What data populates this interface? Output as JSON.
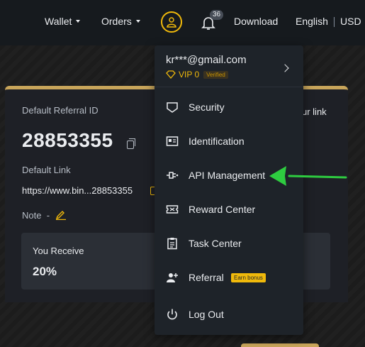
{
  "topbar": {
    "wallet_label": "Wallet",
    "orders_label": "Orders",
    "notification_count": "36",
    "download_label": "Download",
    "language_label": "English",
    "currency_label": "USD"
  },
  "referral": {
    "default_id_label": "Default Referral ID",
    "referral_id": "28853355",
    "default_link_label": "Default Link",
    "default_link": "https://www.bin...28853355",
    "note_label": "Note",
    "note_value": "-",
    "your_link_label": "ur link",
    "you_receive_label": "You Receive",
    "you_receive_value": "20%"
  },
  "dropdown": {
    "email": "kr***@gmail.com",
    "vip_label": "VIP 0",
    "verified_label": "Verified",
    "items": [
      {
        "label": "Security",
        "icon": "security-icon"
      },
      {
        "label": "Identification",
        "icon": "id-card-icon"
      },
      {
        "label": "API Management",
        "icon": "api-plug-icon"
      },
      {
        "label": "Reward Center",
        "icon": "ticket-icon"
      },
      {
        "label": "Task Center",
        "icon": "clipboard-icon"
      },
      {
        "label": "Referral",
        "icon": "add-user-icon",
        "badge": "Earn bonus"
      },
      {
        "label": "Log Out",
        "icon": "power-icon"
      }
    ]
  },
  "colors": {
    "accent": "#f0b90b",
    "gold_border": "#c8a55a",
    "panel_bg": "#1e2329",
    "arrow": "#2ecc40"
  }
}
